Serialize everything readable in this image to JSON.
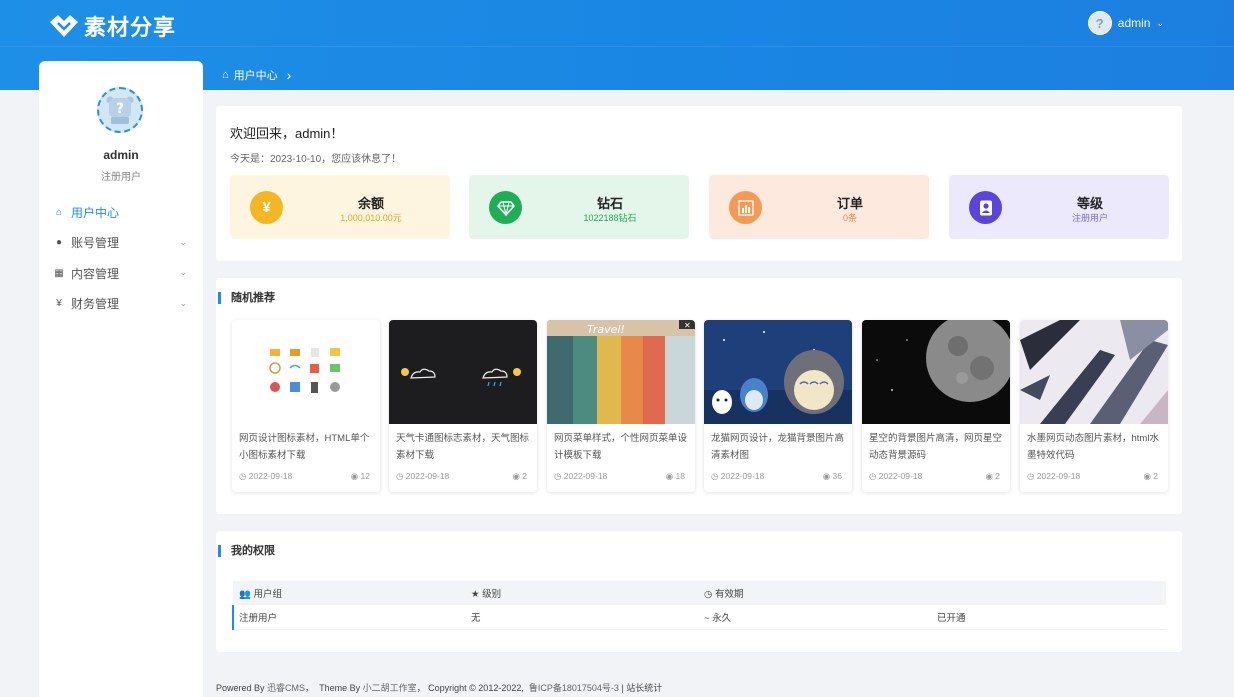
{
  "brand": {
    "name": "素材分享"
  },
  "header": {
    "username": "admin",
    "user_chevron": "⌄"
  },
  "sidebar": {
    "profile_name": "admin",
    "profile_role": "注册用户",
    "items": [
      {
        "label": "用户中心",
        "icon": "home-icon",
        "glyph": "⌂"
      },
      {
        "label": "账号管理",
        "icon": "user-icon",
        "glyph": "●"
      },
      {
        "label": "内容管理",
        "icon": "grid-icon",
        "glyph": "▦"
      },
      {
        "label": "财务管理",
        "icon": "yen-icon",
        "glyph": "¥"
      }
    ]
  },
  "breadcrumb": {
    "label": "用户中心",
    "separator": "›"
  },
  "welcome": {
    "title": "欢迎回来，admin！",
    "subtitle": "今天是：2023-10-10，您应该休息了！"
  },
  "stats": [
    {
      "label": "余额",
      "value": "1,000,010.00元",
      "bg": "#fdf5e0",
      "circle": "#f4b624",
      "value_color": "#e8a71b",
      "icon": "yen-icon"
    },
    {
      "label": "钻石",
      "value": "1022188钻石",
      "bg": "#e4f6ea",
      "circle": "#1fae57",
      "value_color": "#1fae57",
      "icon": "diamond-icon"
    },
    {
      "label": "订单",
      "value": "0条",
      "bg": "#fde9dd",
      "circle": "#f39a55",
      "value_color": "#ef8b44",
      "icon": "bar-chart-icon"
    },
    {
      "label": "等级",
      "value": "注册用户",
      "bg": "#ece9fc",
      "circle": "#5b45d8",
      "value_color": "#7b6be6",
      "icon": "user-icon"
    }
  ],
  "recommend": {
    "title": "随机推荐",
    "items": [
      {
        "title": "网页设计图标素材，HTML单个小图标素材下载",
        "date": "2022-09-18",
        "views": "12"
      },
      {
        "title": "天气卡通图标志素材，天气图标素材下载",
        "date": "2022-09-18",
        "views": "2"
      },
      {
        "title": "网页菜单样式，个性网页菜单设计模板下载",
        "date": "2022-09-18",
        "views": "18"
      },
      {
        "title": "龙猫网页设计，龙猫背景图片高清素材图",
        "date": "2022-09-18",
        "views": "36"
      },
      {
        "title": "星空的背景图片高清，网页星空动态背景源码",
        "date": "2022-09-18",
        "views": "2"
      },
      {
        "title": "水墨网页动态图片素材，html水墨特效代码",
        "date": "2022-09-18",
        "views": "2"
      }
    ]
  },
  "permissions": {
    "title": "我的权限",
    "headers": [
      "用户组",
      "级别",
      "有效期",
      ""
    ],
    "row": [
      "注册用户",
      "无",
      "~ 永久",
      "已开通"
    ]
  },
  "footer": {
    "powered_prefix": "Powered By",
    "cms": "迅睿CMS",
    "theme_prefix": "Theme By",
    "studio": "小二胡工作室",
    "copyright": "Copyright © 2012-2022,",
    "icp": "鲁ICP备18017504号-3",
    "stats_link": "站长统计"
  },
  "colors": {
    "accent": "#1e8fe6",
    "header": "#1a86e4"
  }
}
